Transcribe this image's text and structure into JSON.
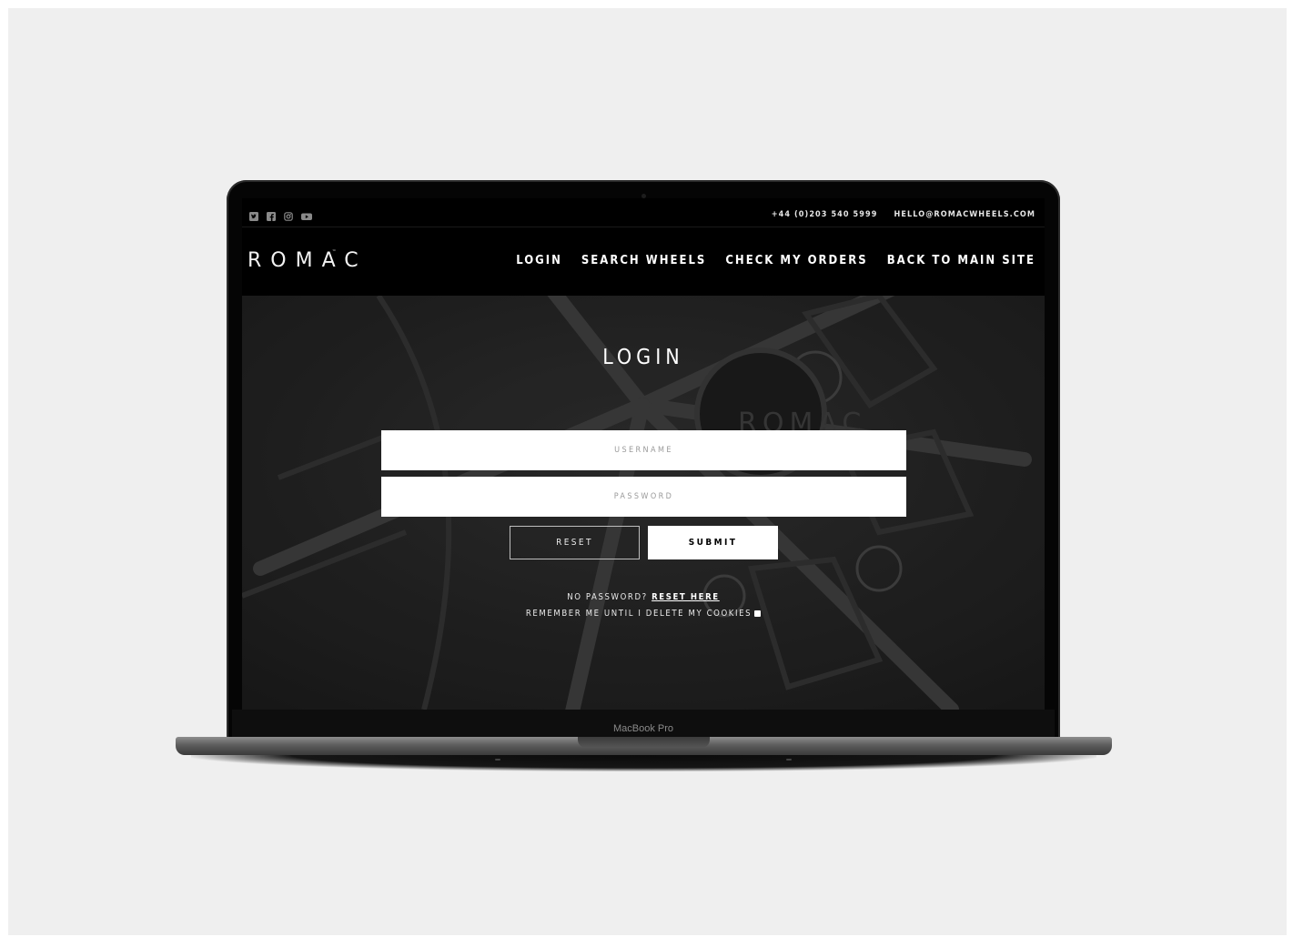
{
  "device": {
    "label": "MacBook Pro"
  },
  "topbar": {
    "social_icons": [
      "twitter-icon",
      "facebook-icon",
      "instagram-icon",
      "youtube-icon"
    ],
    "phone": "+44 (0)203 540 5999",
    "email": "HELLO@ROMACWHEELS.COM"
  },
  "header": {
    "logo": "ROMAC",
    "logo_mark": "™",
    "nav": {
      "login": "LOGIN",
      "search_wheels": "SEARCH WHEELS",
      "check_orders": "CHECK MY ORDERS",
      "back_main": "BACK TO MAIN SITE"
    }
  },
  "login": {
    "title": "LOGIN",
    "username": {
      "placeholder": "USERNAME",
      "value": ""
    },
    "password": {
      "placeholder": "PASSWORD",
      "value": ""
    },
    "reset_label": "RESET",
    "submit_label": "SUBMIT",
    "no_password_text": "NO PASSWORD?",
    "reset_link": "RESET HERE",
    "remember_text": "REMEMBER ME UNTIL I DELETE MY COOKIES",
    "remember_checked": false
  },
  "colors": {
    "page_bg": "#efefef",
    "screen_bg": "#000000",
    "hero_bg": "#262626",
    "accent": "#ffffff"
  }
}
